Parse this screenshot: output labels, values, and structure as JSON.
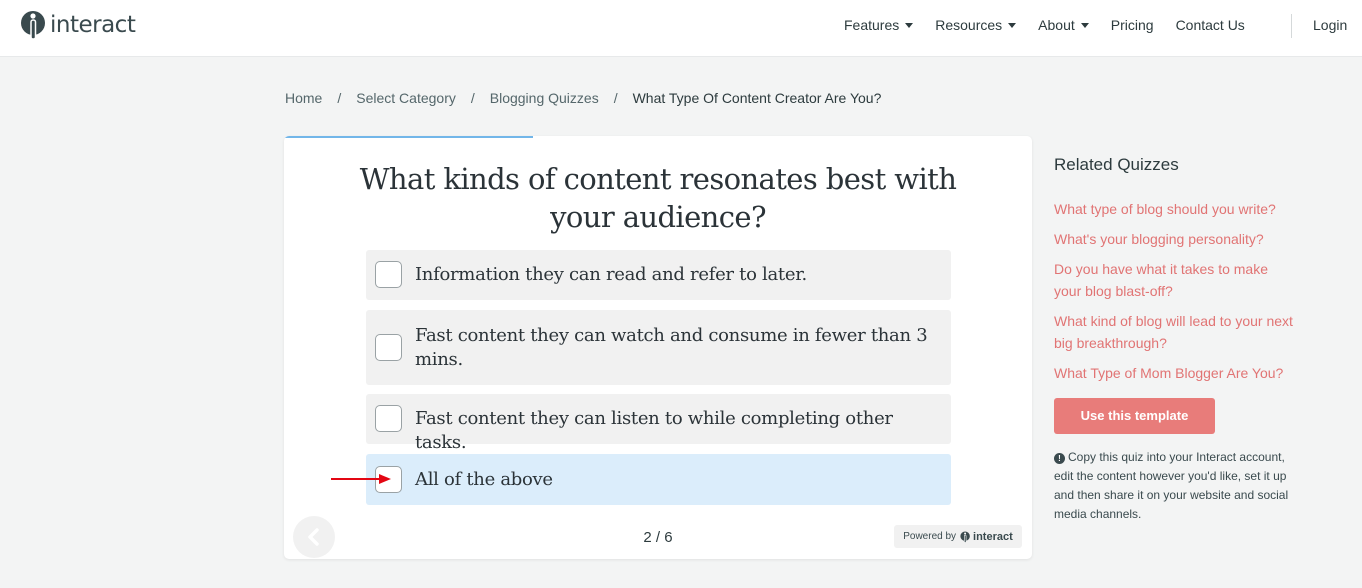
{
  "header": {
    "logo_text": "interact",
    "nav": [
      {
        "label": "Features",
        "has_dropdown": true
      },
      {
        "label": "Resources",
        "has_dropdown": true
      },
      {
        "label": "About",
        "has_dropdown": true
      },
      {
        "label": "Pricing",
        "has_dropdown": false
      },
      {
        "label": "Contact Us",
        "has_dropdown": false
      }
    ],
    "login": "Login"
  },
  "breadcrumb": {
    "items": [
      "Home",
      "Select Category",
      "Blogging Quizzes"
    ],
    "current": "What Type Of Content Creator Are You?",
    "separator": "/"
  },
  "quiz": {
    "progress_fraction": 0.333,
    "question": "What kinds of content resonates best with your audience?",
    "answers": [
      {
        "text": "Information they can read and refer to later.",
        "selected": false
      },
      {
        "text": "Fast content they can watch and consume in fewer than 3 mins.",
        "selected": false
      },
      {
        "text": "Fast content they can listen to while completing other tasks.",
        "selected": false
      },
      {
        "text": "All of the above",
        "selected": true
      }
    ],
    "page_count": "2 / 6",
    "powered_by": "Powered by",
    "powered_brand": "interact"
  },
  "sidebar": {
    "title": "Related Quizzes",
    "links": [
      "What type of blog should you write?",
      "What's your blogging personality?",
      "Do you have what it takes to make your blog blast-off?",
      "What kind of blog will lead to your next big breakthrough?",
      "What Type of Mom Blogger Are You?"
    ],
    "cta_label": "Use this template",
    "info_text": "Copy this quiz into your Interact account, edit the content however you'd like, set it up and then share it on your website and social media channels."
  },
  "colors": {
    "accent": "#e87c7a",
    "link": "#e17474",
    "progress": "#72b6e9",
    "selected_answer": "#dbedfb",
    "annotation_arrow": "#e30613"
  },
  "icons": {
    "logo": "interact-logo-icon",
    "back": "chevron-left-icon",
    "info": "info-icon",
    "annotation": "red-arrow-icon"
  }
}
